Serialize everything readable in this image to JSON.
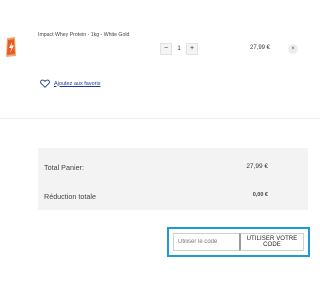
{
  "cart_item": {
    "name": "Impact Whey Protein - 1kg - White Gold",
    "quantity": "1",
    "decrease_label": "−",
    "increase_label": "+",
    "price": "27,99 €",
    "remove_label": "×",
    "thumbnail_icon": "product-bag-icon"
  },
  "favorites": {
    "icon": "heart-icon",
    "label": "Ajoutez aux favoris"
  },
  "totals": {
    "total_label": "Total Panier:",
    "total_value": "27,99 €",
    "discount_label": "Réduction totale",
    "discount_value": "0,00 €"
  },
  "promo": {
    "placeholder": "Utiliser le code",
    "button_label": "UTILISER VOTRE CODE",
    "highlight_color": "#1e9ad6"
  }
}
